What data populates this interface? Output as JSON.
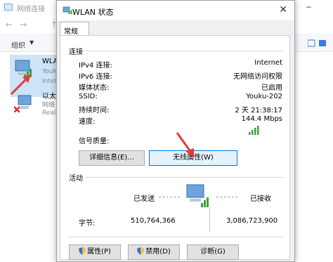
{
  "background_window": {
    "title": "网络连接",
    "nav": {
      "back": "←",
      "forward": "→",
      "up": "↑"
    },
    "toolbar": {
      "organize": "组织",
      "organize_caret": "▼"
    },
    "adapters": [
      {
        "name": "WLAN",
        "line1": "Youku",
        "line2": "Intel"
      },
      {
        "name": "以太",
        "line1": "网络",
        "line2": "Real"
      }
    ]
  },
  "dialog": {
    "title": "WLAN 状态",
    "close": "✕",
    "tab": "常规",
    "connection": {
      "heading": "连接",
      "rows": [
        {
          "key": "IPv4 连接:",
          "value": "Internet"
        },
        {
          "key": "IPv6 连接:",
          "value": "无网络访问权限"
        },
        {
          "key": "媒体状态:",
          "value": "已启用"
        },
        {
          "key": "SSID:",
          "value": "Youku-202"
        },
        {
          "key": "持续时间:",
          "value": "2 天 21:38:17"
        },
        {
          "key": "速度:",
          "value": "144.4 Mbps"
        }
      ],
      "signal_label": "信号质量:",
      "signal_level": 1.0,
      "details_button": "详细信息(E)...",
      "wireless_button": "无线属性(W)"
    },
    "activity": {
      "heading": "活动",
      "sent_label": "已发送",
      "received_label": "已接收",
      "bytes_label": "字节:",
      "sent_bytes": "510,764,366",
      "received_bytes": "3,086,723,900"
    },
    "buttons": {
      "properties": "属性(P)",
      "disable": "禁用(D)",
      "diagnose": "诊断(G)"
    }
  },
  "colors": {
    "signal_green": "#3aa03a",
    "focus_blue": "#0078d7",
    "arrow_red": "#e53935",
    "selection": "#cce4f7"
  }
}
